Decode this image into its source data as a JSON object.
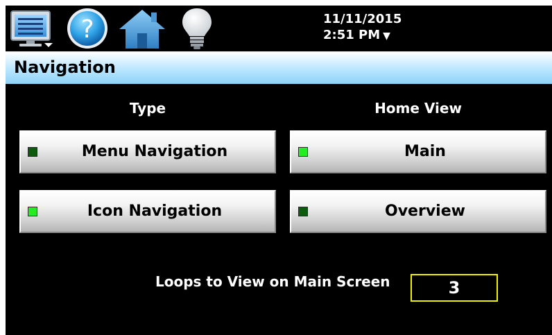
{
  "topbar": {
    "icons": {
      "menu": "menu-monitor-icon",
      "help": "help-question-icon",
      "home": "home-icon",
      "light": "lightbulb-icon"
    },
    "date": "11/11/2015",
    "time": "2:51 PM",
    "time_dropdown_glyph": "▼"
  },
  "header": {
    "title": "Navigation"
  },
  "type_section": {
    "heading": "Type",
    "options": [
      {
        "label": "Menu Navigation",
        "selected": false
      },
      {
        "label": "Icon Navigation",
        "selected": true
      }
    ]
  },
  "home_view_section": {
    "heading": "Home View",
    "options": [
      {
        "label": "Main",
        "selected": true
      },
      {
        "label": "Overview",
        "selected": false
      }
    ]
  },
  "loops": {
    "label": "Loops to View on Main Screen",
    "value": "3"
  },
  "colors": {
    "background": "#000000",
    "header_gradient_top": "#ffffff",
    "header_gradient_bottom": "#8fd2f7",
    "indicator_on": "#22ee22",
    "indicator_off": "#0d5c0d",
    "field_border": "#f2f200"
  }
}
